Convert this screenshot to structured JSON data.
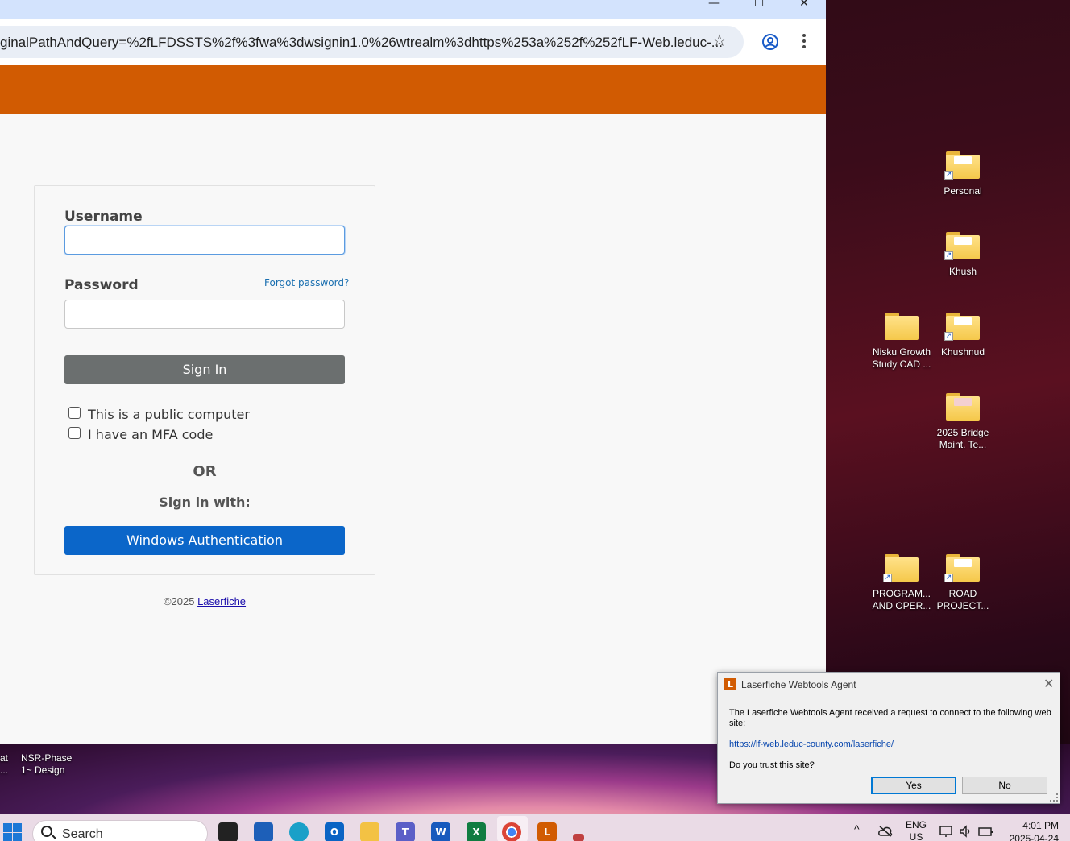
{
  "browser": {
    "url": "ginalPathAndQuery=%2fLFDSSTS%2f%3fwa%3dwsignin1.0%26wtrealm%3dhttps%253a%252f%252fLF-Web.leduc-...",
    "window_controls": {
      "minimize": "—",
      "maximize": "☐",
      "close": "✕"
    },
    "star": "☆"
  },
  "login": {
    "username_label": "Username",
    "username_value": "",
    "password_label": "Password",
    "password_value": "",
    "forgot_password": "Forgot password?",
    "sign_in": "Sign In",
    "public_computer": "This is a public computer",
    "mfa_code": "I have an MFA code",
    "or": "OR",
    "sign_in_with": "Sign in with:",
    "windows_auth": "Windows Authentication",
    "copyright": "©2025",
    "brand_link": "Laserfiche"
  },
  "desktop": {
    "icons": [
      {
        "label": "Personal"
      },
      {
        "label": "Khush"
      },
      {
        "label": "Nisku Growth Study CAD ..."
      },
      {
        "label": "Khushnud"
      },
      {
        "label": "2025 Bridge Maint. Te..."
      },
      {
        "label": "PROGRAM... AND OPER..."
      },
      {
        "label": "ROAD PROJECT..."
      }
    ],
    "partial_icons": [
      {
        "label": "at\n..."
      },
      {
        "label": "NSR-Phase\n1~ Design"
      }
    ]
  },
  "dialog": {
    "logo": "L",
    "title": "Laserfiche Webtools Agent",
    "message": "The Laserfiche Webtools Agent received a request to connect to the following web site:",
    "link": "https://lf-web.leduc-county.com/laserfiche/",
    "question": "Do you trust this site?",
    "yes": "Yes",
    "no": "No",
    "close": "✕"
  },
  "taskbar": {
    "search_placeholder": "Search",
    "apps": [
      "task-view",
      "store",
      "edge",
      "outlook",
      "file-explorer",
      "teams",
      "word",
      "excel",
      "chrome",
      "laserfiche",
      "other"
    ],
    "app_letters": {
      "outlook": "O",
      "word": "W",
      "excel": "X",
      "teams": "T",
      "laserfiche": "L"
    },
    "tray": {
      "chevron": "^",
      "lang": "ENG",
      "region": "US"
    },
    "time": "4:01 PM",
    "date": "2025-04-24"
  },
  "colors": {
    "orange": "#d15b02",
    "signin_button": "#6b6f6f",
    "winauth_button": "#0b66c9"
  }
}
